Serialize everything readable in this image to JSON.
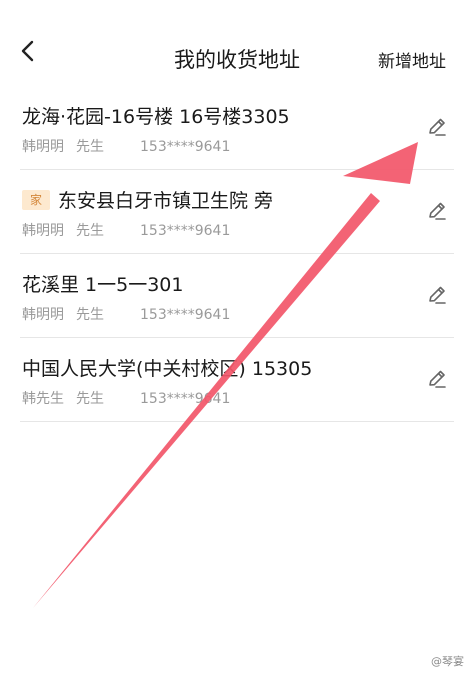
{
  "header": {
    "title": "我的收货地址",
    "add_label": "新增地址"
  },
  "addresses": [
    {
      "address": "龙海·花园-16号楼 16号楼3305",
      "tag": "",
      "name": "韩明明",
      "title": "先生",
      "phone": "153****9641"
    },
    {
      "address": "东安县白牙市镇卫生院 旁",
      "tag": "家",
      "name": "韩明明",
      "title": "先生",
      "phone": "153****9641"
    },
    {
      "address": "花溪里 1一5一301",
      "tag": "",
      "name": "韩明明",
      "title": "先生",
      "phone": "153****9641"
    },
    {
      "address": "中国人民大学(中关村校区) 15305",
      "tag": "",
      "name": "韩先生",
      "title": "先生",
      "phone": "153****9641"
    }
  ],
  "watermark": "@琴宴",
  "colors": {
    "accent": "#f2576b",
    "tag_bg": "#fde9cf",
    "tag_text": "#d4873a",
    "muted": "#9a9a9a"
  },
  "icons": {
    "back": "chevron-left-icon",
    "edit": "pencil-icon"
  }
}
